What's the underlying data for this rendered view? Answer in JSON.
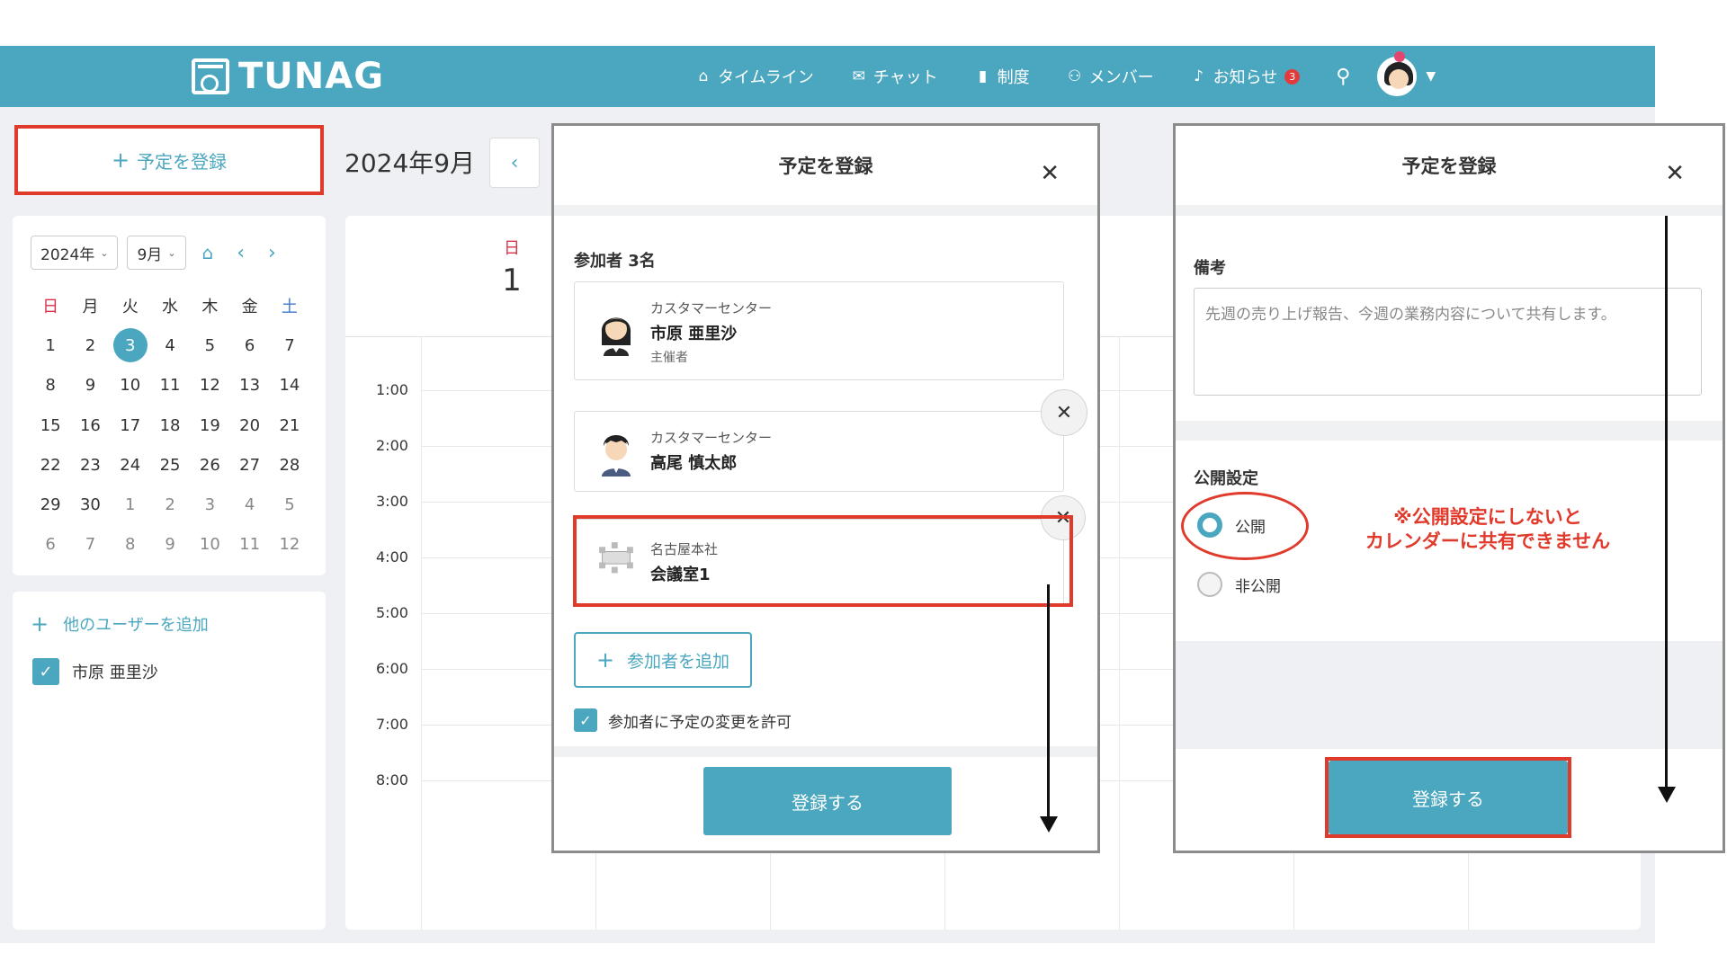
{
  "header": {
    "logo_text": "TUNAG",
    "nav": [
      {
        "label": "タイムライン",
        "icon": "home-icon",
        "glyph": "⌂"
      },
      {
        "label": "チャット",
        "icon": "chat-icon",
        "glyph": "✉"
      },
      {
        "label": "制度",
        "icon": "book-icon",
        "glyph": "▮"
      },
      {
        "label": "メンバー",
        "icon": "members-icon",
        "glyph": "⚇"
      },
      {
        "label": "お知らせ",
        "icon": "bell-icon",
        "glyph": "♪",
        "badge": "3"
      }
    ]
  },
  "sidebar": {
    "add_event_label": "予定を登録",
    "year_select": "2024年",
    "month_select": "9月",
    "weekdays": [
      "日",
      "月",
      "火",
      "水",
      "木",
      "金",
      "土"
    ],
    "weeks": [
      [
        "1",
        "2",
        "3",
        "4",
        "5",
        "6",
        "7"
      ],
      [
        "8",
        "9",
        "10",
        "11",
        "12",
        "13",
        "14"
      ],
      [
        "15",
        "16",
        "17",
        "18",
        "19",
        "20",
        "21"
      ],
      [
        "22",
        "23",
        "24",
        "25",
        "26",
        "27",
        "28"
      ],
      [
        "29",
        "30",
        "1",
        "2",
        "3",
        "4",
        "5"
      ],
      [
        "6",
        "7",
        "8",
        "9",
        "10",
        "11",
        "12"
      ]
    ],
    "today": "3",
    "add_user_label": "他のユーザーを追加",
    "users": [
      {
        "name": "市原 亜里沙",
        "checked": true
      }
    ]
  },
  "main": {
    "month_title": "2024年9月",
    "day_header": {
      "dow": "日",
      "date": "1"
    },
    "times": [
      "1:00",
      "2:00",
      "3:00",
      "4:00",
      "5:00",
      "6:00",
      "7:00",
      "8:00"
    ]
  },
  "modal_a": {
    "title": "予定を登録",
    "participants_label": "参加者 3名",
    "participants": [
      {
        "dept": "カスタマーセンター",
        "name": "市原 亜里沙",
        "role": "主催者"
      },
      {
        "dept": "カスタマーセンター",
        "name": "高尾 慎太郎",
        "role": ""
      },
      {
        "dept": "名古屋本社",
        "name": "会議室1",
        "role": ""
      }
    ],
    "add_participant_label": "参加者を追加",
    "allow_change_label": "参加者に予定の変更を許可",
    "submit_label": "登録する"
  },
  "modal_b": {
    "title": "予定を登録",
    "notes_label": "備考",
    "notes_value": "先週の売り上げ報告、今週の業務内容について共有します。",
    "visibility_label": "公開設定",
    "options": [
      "公開",
      "非公開"
    ],
    "selected": "公開",
    "notice_line1": "※公開設定にしないと",
    "notice_line2": "カレンダーに共有できません",
    "submit_label": "登録する"
  },
  "colors": {
    "accent": "#4aa7bf",
    "highlight": "#e03a2c",
    "sunday": "#d6334a",
    "saturday": "#3f77c9"
  }
}
